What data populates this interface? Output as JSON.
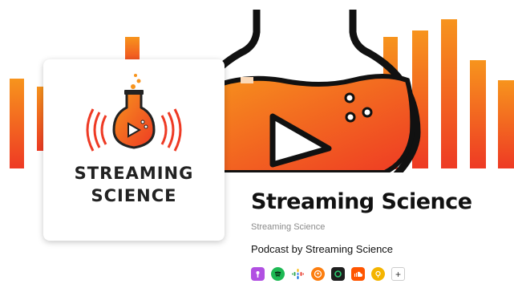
{
  "podcast": {
    "title": "Streaming Science",
    "author_link": "Streaming Science",
    "subtitle": "Podcast by Streaming Science",
    "artwork_text": [
      "STREAMING",
      "SCIENCE"
    ]
  },
  "platforms": [
    {
      "icon": "apple-podcasts-icon",
      "color": "#b150e2"
    },
    {
      "icon": "spotify-icon",
      "color": "#1db954"
    },
    {
      "icon": "google-podcasts-icon",
      "color": "#4285f4"
    },
    {
      "icon": "overcast-icon",
      "color": "#fc7e0f"
    },
    {
      "icon": "castbox-icon",
      "color": "#1e1e1e"
    },
    {
      "icon": "soundcloud-icon",
      "color": "#ff5500"
    },
    {
      "icon": "podcast-addict-icon",
      "color": "#f4b400"
    },
    {
      "icon": "more-icon",
      "label": "+"
    }
  ],
  "colors": {
    "accent": "#f15a22",
    "accent_light": "#f7941d"
  }
}
